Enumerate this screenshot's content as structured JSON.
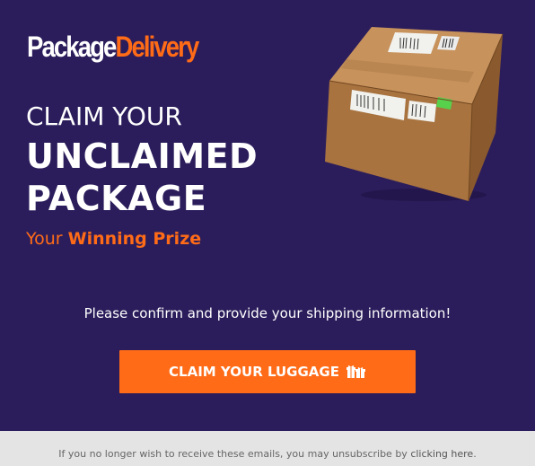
{
  "brand": {
    "name_part1": "Package",
    "name_part2": "Delivery"
  },
  "hero": {
    "line1": "CLAIM YOUR",
    "line2": "UNCLAIMED",
    "line3": "PACKAGE",
    "subtitle_prefix": "Your",
    "subtitle_highlight": "Winning Prize"
  },
  "message": "Please confirm and provide your shipping information!",
  "cta": {
    "label": "CLAIM YOUR LUGGAGE",
    "icon": "gifts-icon"
  },
  "footer": {
    "text": "If you no longer wish to receive these emails, you may unsubscribe by",
    "link_label": "clicking here",
    "suffix": "."
  },
  "colors": {
    "background": "#2b1d5b",
    "accent": "#ff6b17",
    "footer_bg": "#e4e4e4"
  }
}
